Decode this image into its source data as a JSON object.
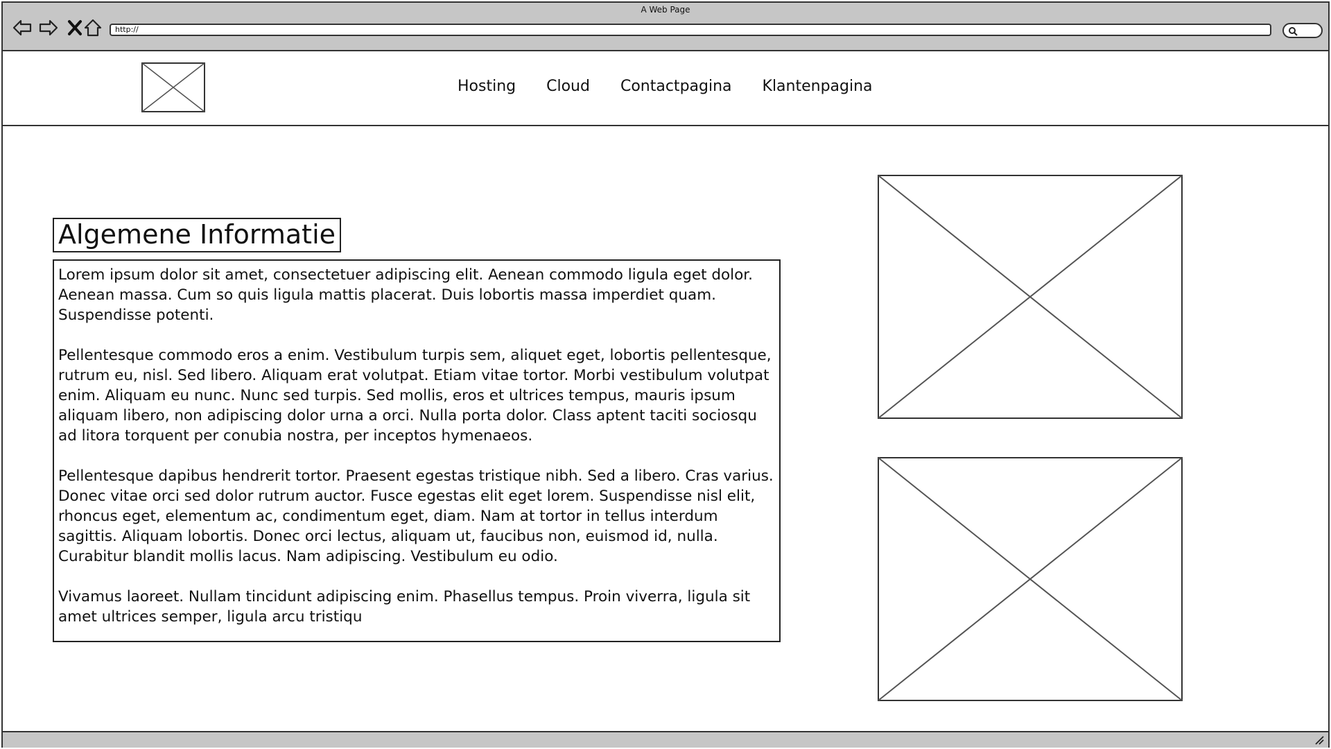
{
  "window": {
    "title": "A Web Page"
  },
  "browser": {
    "url": "http://",
    "icons": [
      "back-arrow-icon",
      "forward-arrow-icon",
      "close-x-icon",
      "home-icon",
      "search-icon"
    ]
  },
  "header": {
    "nav": [
      "Hosting",
      "Cloud",
      "Contactpagina",
      "Klantenpagina"
    ]
  },
  "main": {
    "heading": "Algemene Informatie",
    "paragraphs": [
      "Lorem ipsum dolor sit amet, consectetuer adipiscing elit. Aenean commodo ligula eget dolor. Aenean massa. Cum so quis ligula mattis placerat. Duis lobortis massa imperdiet quam. Suspendisse potenti.",
      "Pellentesque commodo eros a enim. Vestibulum turpis sem, aliquet eget, lobortis pellentesque, rutrum eu, nisl. Sed libero. Aliquam erat volutpat. Etiam vitae tortor. Morbi vestibulum volutpat enim. Aliquam eu nunc. Nunc sed turpis. Sed mollis, eros et ultrices tempus, mauris ipsum aliquam libero, non adipiscing dolor urna a orci. Nulla porta dolor. Class aptent taciti sociosqu ad litora torquent per conubia nostra, per inceptos hymenaeos.",
      "Pellentesque dapibus hendrerit tortor. Praesent egestas tristique nibh. Sed a libero. Cras varius. Donec vitae orci sed dolor rutrum auctor. Fusce egestas elit eget lorem. Suspendisse nisl elit, rhoncus eget, elementum ac, condimentum eget, diam. Nam at tortor in tellus interdum sagittis. Aliquam lobortis. Donec orci lectus, aliquam ut, faucibus non, euismod id, nulla. Curabitur blandit mollis lacus. Nam adipiscing. Vestibulum eu odio.",
      "Vivamus laoreet. Nullam tincidunt adipiscing enim. Phasellus tempus. Proin viverra, ligula sit amet ultrices semper, ligula arcu tristiqu"
    ]
  },
  "colors": {
    "chrome": "#c6c6c6",
    "stroke": "#333333"
  }
}
